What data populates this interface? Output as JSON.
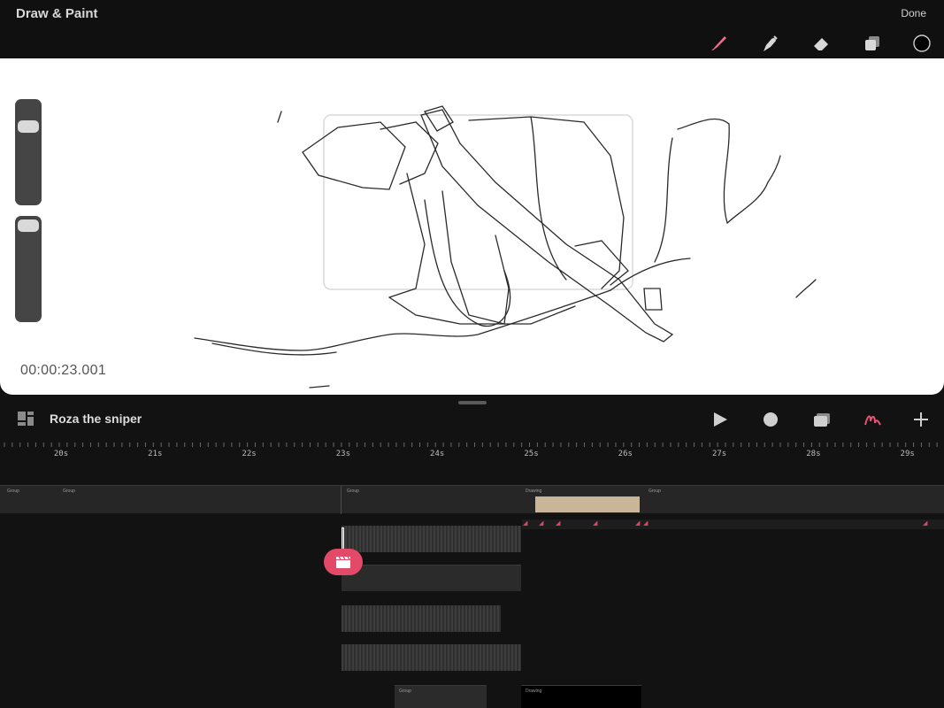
{
  "app": {
    "title": "Draw & Paint",
    "done_label": "Done"
  },
  "tools": [
    {
      "icon": "brush-icon",
      "active": true
    },
    {
      "icon": "smudge-icon"
    },
    {
      "icon": "eraser-icon"
    },
    {
      "icon": "layers-icon"
    },
    {
      "icon": "color-icon"
    }
  ],
  "canvas": {
    "timecode": "00:00:23.001",
    "brush_size_level": 0.15,
    "opacity_level": 0.05
  },
  "timeline": {
    "project_name": "Roza the sniper",
    "controls": [
      "play-icon",
      "record-icon",
      "onion-skin-icon",
      "draw-icon",
      "add-icon"
    ],
    "ruler_labels": [
      "20s",
      "21s",
      "22s",
      "23s",
      "24s",
      "25s",
      "26s",
      "27s",
      "28s",
      "29s"
    ],
    "clips": {
      "group_a": "Group",
      "group_b": "Group",
      "group_c": "Group",
      "drawing_a": "Drawing",
      "group_d": "Group",
      "group_e": "Group",
      "drawing_b": "Drawing"
    }
  },
  "colors": {
    "accent": "#e34a67",
    "background": "#121212",
    "canvas": "#ffffff"
  }
}
